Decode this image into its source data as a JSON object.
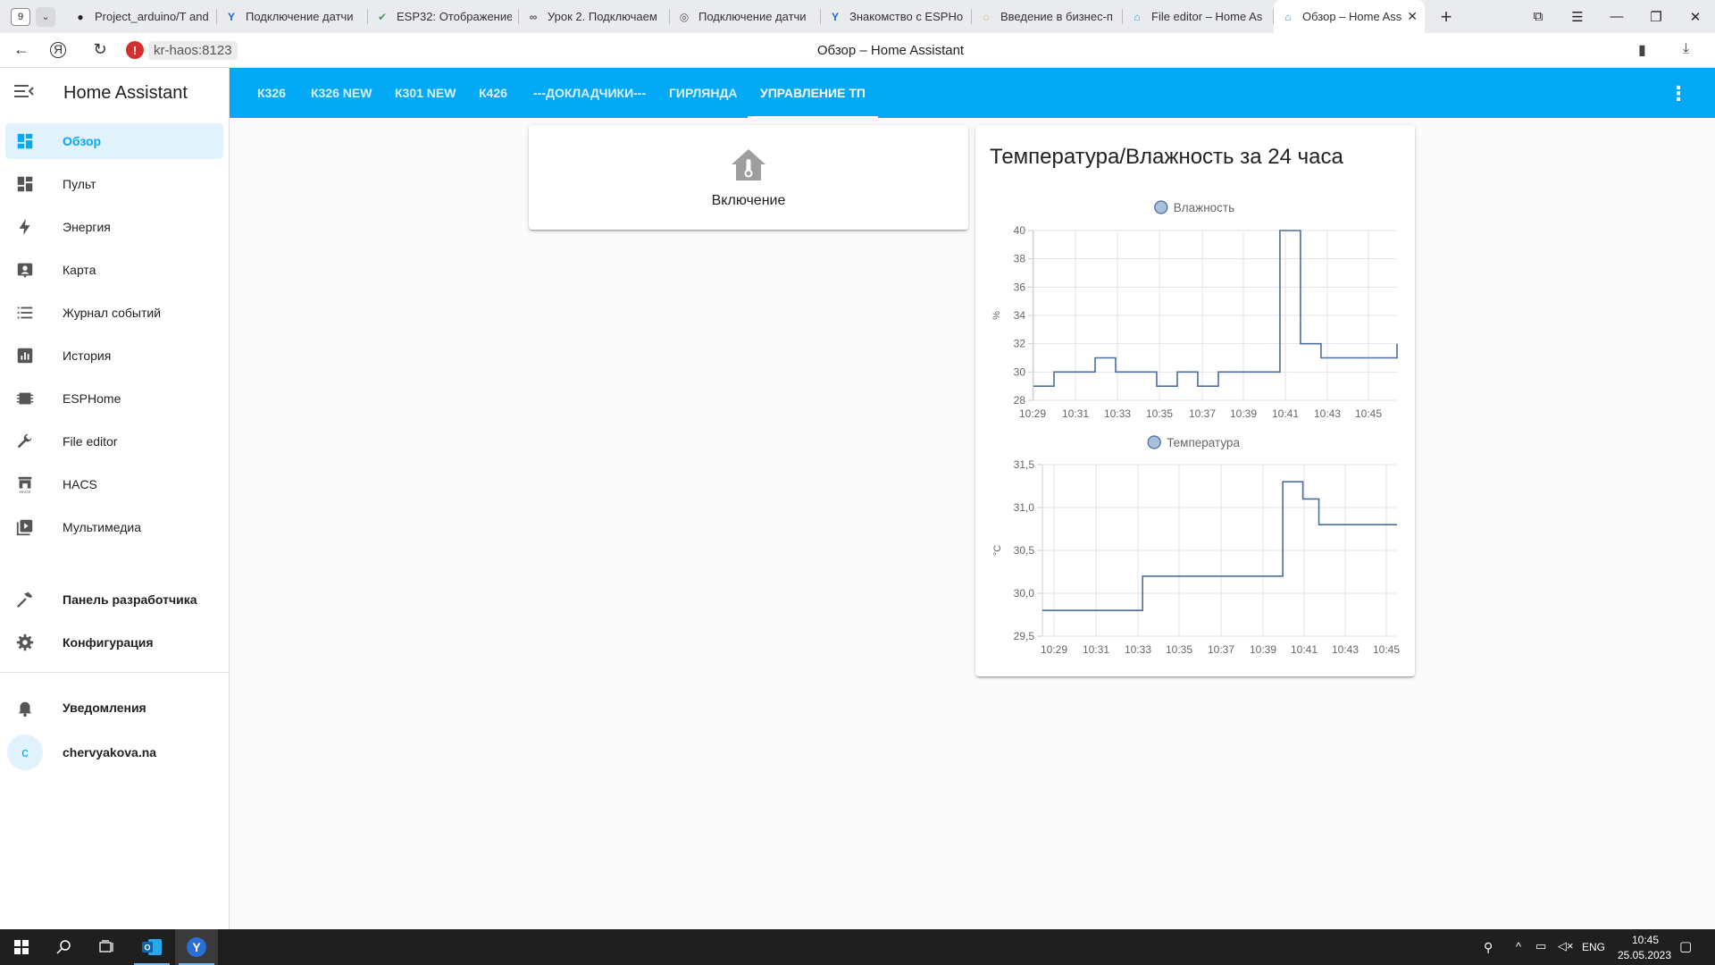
{
  "browser": {
    "tab_count": "9",
    "tabs": [
      {
        "title": "Project_arduino/T and",
        "icon": "github-icon",
        "glyph": "●"
      },
      {
        "title": "Подключение датчи",
        "icon": "yandex-y-icon",
        "glyph": "Y"
      },
      {
        "title": "ESP32: Отображение",
        "icon": "leaf-icon",
        "glyph": "✔"
      },
      {
        "title": "Урок 2. Подключаем",
        "icon": "infinity-icon",
        "glyph": "∞"
      },
      {
        "title": "Подключение датчи",
        "icon": "page-icon",
        "glyph": "◎"
      },
      {
        "title": "Знакомство с ESPHo",
        "icon": "yandex-y-icon",
        "glyph": "Y"
      },
      {
        "title": "Введение в бизнес-п",
        "icon": "color-ring-icon",
        "glyph": "◌"
      },
      {
        "title": "File editor – Home As",
        "icon": "home-assistant-icon",
        "glyph": "⌂"
      },
      {
        "title": "Обзор – Home Ass",
        "icon": "home-assistant-icon",
        "glyph": "⌂"
      }
    ],
    "url": "kr-haos:8123",
    "page_title": "Обзор – Home Assistant"
  },
  "sidebar": {
    "title": "Home Assistant",
    "items": [
      {
        "label": "Обзор",
        "icon": "dashboard-icon"
      },
      {
        "label": "Пульт",
        "icon": "dashboard-outline-icon"
      },
      {
        "label": "Энергия",
        "icon": "lightning-icon"
      },
      {
        "label": "Карта",
        "icon": "map-account-icon"
      },
      {
        "label": "Журнал событий",
        "icon": "list-icon"
      },
      {
        "label": "История",
        "icon": "chart-box-icon"
      },
      {
        "label": "ESPHome",
        "icon": "chip-icon"
      },
      {
        "label": "File editor",
        "icon": "wrench-icon"
      },
      {
        "label": "HACS",
        "icon": "hacs-icon"
      },
      {
        "label": "Мультимедиа",
        "icon": "media-play-icon"
      }
    ],
    "developer": "Панель разработчика",
    "config": "Конфигурация",
    "notifications": "Уведомления",
    "user_initial": "c",
    "user_name": "chervyakova.na"
  },
  "views": [
    "К326",
    "К326 NEW",
    "К301 NEW",
    "К426",
    "---ДОКЛАДЧИКИ---",
    "ГИРЛЯНДА",
    "УПРАВЛЕНИЕ ТП"
  ],
  "button_card": {
    "label": "Включение",
    "icon": "home-thermometer-icon"
  },
  "graph_card": {
    "title": "Температура/Влажность за 24 часа"
  },
  "chart_data": [
    {
      "type": "line",
      "step": true,
      "legend": "top",
      "grid": true,
      "ylabel": "%",
      "ylim": [
        28,
        40
      ],
      "yticks": [
        "28",
        "30",
        "32",
        "34",
        "36",
        "38",
        "40"
      ],
      "xticks": [
        "10:29",
        "10:31",
        "10:33",
        "10:35",
        "10:37",
        "10:39",
        "10:41",
        "10:43",
        "10:45"
      ],
      "xlim": [
        "10:28.4",
        "10:46.1"
      ],
      "series": [
        {
          "name": "Влажность",
          "color": "#4b6e9a",
          "x": [
            "10:28.4",
            "10:29.4",
            "10:31.4",
            "10:32.4",
            "10:34.4",
            "10:35.4",
            "10:36.4",
            "10:37.4",
            "10:38.4",
            "10:40.4",
            "10:41.4",
            "10:42.4",
            "10:45.4",
            "10:46.1"
          ],
          "values": [
            29,
            30,
            31,
            30,
            29,
            30,
            29,
            30,
            30,
            40,
            32,
            31,
            31,
            32
          ]
        }
      ]
    },
    {
      "type": "line",
      "step": true,
      "legend": "top",
      "grid": true,
      "ylabel": "°C",
      "ylim": [
        29.5,
        31.5
      ],
      "yticks": [
        "29,5",
        "30,0",
        "30,5",
        "31,0",
        "31,5"
      ],
      "xticks": [
        "10:29",
        "10:31",
        "10:33",
        "10:35",
        "10:37",
        "10:39",
        "10:41",
        "10:43",
        "10:45"
      ],
      "xlim": [
        "10:28.4",
        "10:46.1"
      ],
      "series": [
        {
          "name": "Температура",
          "color": "#4b6e9a",
          "x": [
            "10:28.4",
            "10:33.4",
            "10:40.4",
            "10:41.4",
            "10:42.2",
            "10:46.1"
          ],
          "values": [
            29.8,
            30.2,
            31.3,
            31.1,
            30.8,
            30.8
          ]
        }
      ]
    }
  ],
  "taskbar": {
    "lang": "ENG",
    "time": "10:45",
    "date": "25.05.2023"
  }
}
